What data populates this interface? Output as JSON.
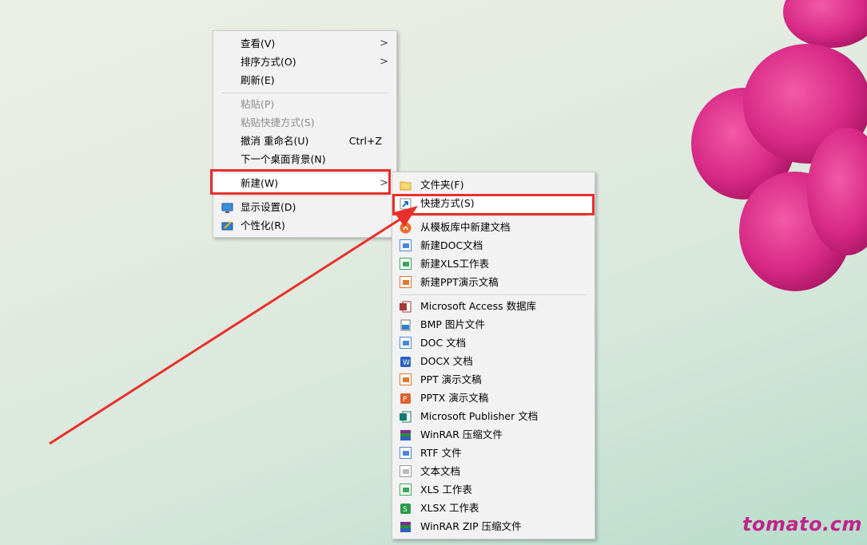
{
  "desktop": {
    "watermark": "tomato.cm"
  },
  "context_menu": {
    "items": [
      {
        "label": "查看(V)",
        "has_submenu": true
      },
      {
        "label": "排序方式(O)",
        "has_submenu": true
      },
      {
        "label": "刷新(E)"
      },
      {
        "label": "粘贴(P)",
        "disabled": true
      },
      {
        "label": "粘贴快捷方式(S)",
        "disabled": true
      },
      {
        "label": "撤消 重命名(U)",
        "shortcut": "Ctrl+Z"
      },
      {
        "label": "下一个桌面背景(N)"
      },
      {
        "label": "新建(W)",
        "has_submenu": true,
        "highlighted": true
      },
      {
        "label": "显示设置(D)",
        "icon": "display-icon"
      },
      {
        "label": "个性化(R)",
        "icon": "personalize-icon"
      }
    ]
  },
  "new_submenu": {
    "items": [
      {
        "label": "文件夹(F)",
        "icon": "folder-icon"
      },
      {
        "label": "快捷方式(S)",
        "icon": "shortcut-icon",
        "highlighted": true
      },
      {
        "label": "从模板库中新建文档",
        "icon": "template-icon"
      },
      {
        "label": "新建DOC文档",
        "icon": "wps-doc-icon"
      },
      {
        "label": "新建XLS工作表",
        "icon": "wps-xls-icon"
      },
      {
        "label": "新建PPT演示文稿",
        "icon": "wps-ppt-icon"
      },
      {
        "label": "Microsoft Access 数据库",
        "icon": "access-icon"
      },
      {
        "label": "BMP 图片文件",
        "icon": "bmp-icon"
      },
      {
        "label": "DOC 文档",
        "icon": "doc-icon"
      },
      {
        "label": "DOCX 文档",
        "icon": "docx-icon"
      },
      {
        "label": "PPT 演示文稿",
        "icon": "ppt-icon"
      },
      {
        "label": "PPTX 演示文稿",
        "icon": "pptx-icon"
      },
      {
        "label": "Microsoft Publisher 文档",
        "icon": "publisher-icon"
      },
      {
        "label": "WinRAR 压缩文件",
        "icon": "winrar-icon"
      },
      {
        "label": "RTF 文件",
        "icon": "rtf-icon"
      },
      {
        "label": "文本文档",
        "icon": "txt-icon"
      },
      {
        "label": "XLS 工作表",
        "icon": "xls-icon"
      },
      {
        "label": "XLSX 工作表",
        "icon": "xlsx-icon"
      },
      {
        "label": "WinRAR ZIP 压缩文件",
        "icon": "winrar-zip-icon"
      }
    ]
  },
  "colors": {
    "annotation_red": "#e8302c",
    "menu_bg": "#f2f2f2",
    "watermark": "#c0248a"
  }
}
